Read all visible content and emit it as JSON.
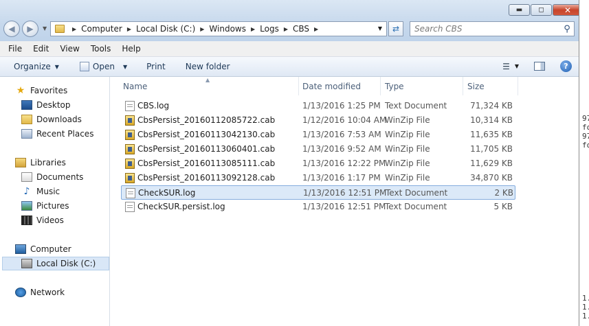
{
  "address": {
    "crumbs": [
      "Computer",
      "Local Disk (C:)",
      "Windows",
      "Logs",
      "CBS"
    ]
  },
  "search": {
    "placeholder": "Search CBS"
  },
  "window_buttons": {
    "minimize": "▬",
    "maximize": "◻",
    "close": "✕"
  },
  "menu": [
    "File",
    "Edit",
    "View",
    "Tools",
    "Help"
  ],
  "commands": {
    "organize": "Organize",
    "open": "Open",
    "print": "Print",
    "new_folder": "New folder"
  },
  "nav": {
    "favorites": "Favorites",
    "desktop": "Desktop",
    "downloads": "Downloads",
    "recent_places": "Recent Places",
    "libraries": "Libraries",
    "documents": "Documents",
    "music": "Music",
    "pictures": "Pictures",
    "videos": "Videos",
    "computer": "Computer",
    "local_disk": "Local Disk (C:)",
    "network": "Network"
  },
  "columns": {
    "name": "Name",
    "date": "Date modified",
    "type": "Type",
    "size": "Size"
  },
  "files": [
    {
      "name": "CBS.log",
      "date": "1/13/2016 1:25 PM",
      "type": "Text Document",
      "size": "71,324 KB",
      "icon": "text"
    },
    {
      "name": "CbsPersist_20160112085722.cab",
      "date": "1/12/2016 10:04 AM",
      "type": "WinZip File",
      "size": "10,314 KB",
      "icon": "cab"
    },
    {
      "name": "CbsPersist_20160113042130.cab",
      "date": "1/13/2016 7:53 AM",
      "type": "WinZip File",
      "size": "11,635 KB",
      "icon": "cab"
    },
    {
      "name": "CbsPersist_20160113060401.cab",
      "date": "1/13/2016 9:52 AM",
      "type": "WinZip File",
      "size": "11,705 KB",
      "icon": "cab"
    },
    {
      "name": "CbsPersist_20160113085111.cab",
      "date": "1/13/2016 12:22 PM",
      "type": "WinZip File",
      "size": "11,629 KB",
      "icon": "cab"
    },
    {
      "name": "CbsPersist_20160113092128.cab",
      "date": "1/13/2016 1:17 PM",
      "type": "WinZip File",
      "size": "34,870 KB",
      "icon": "cab"
    },
    {
      "name": "CheckSUR.log",
      "date": "1/13/2016 12:51 PM",
      "type": "Text Document",
      "size": "2 KB",
      "icon": "text",
      "selected": true
    },
    {
      "name": "CheckSUR.persist.log",
      "date": "1/13/2016 12:51 PM",
      "type": "Text Document",
      "size": "5 KB",
      "icon": "text"
    }
  ],
  "background_fragments": [
    "97",
    "fo",
    "97",
    "fo",
    "1.",
    "1.",
    "1."
  ]
}
